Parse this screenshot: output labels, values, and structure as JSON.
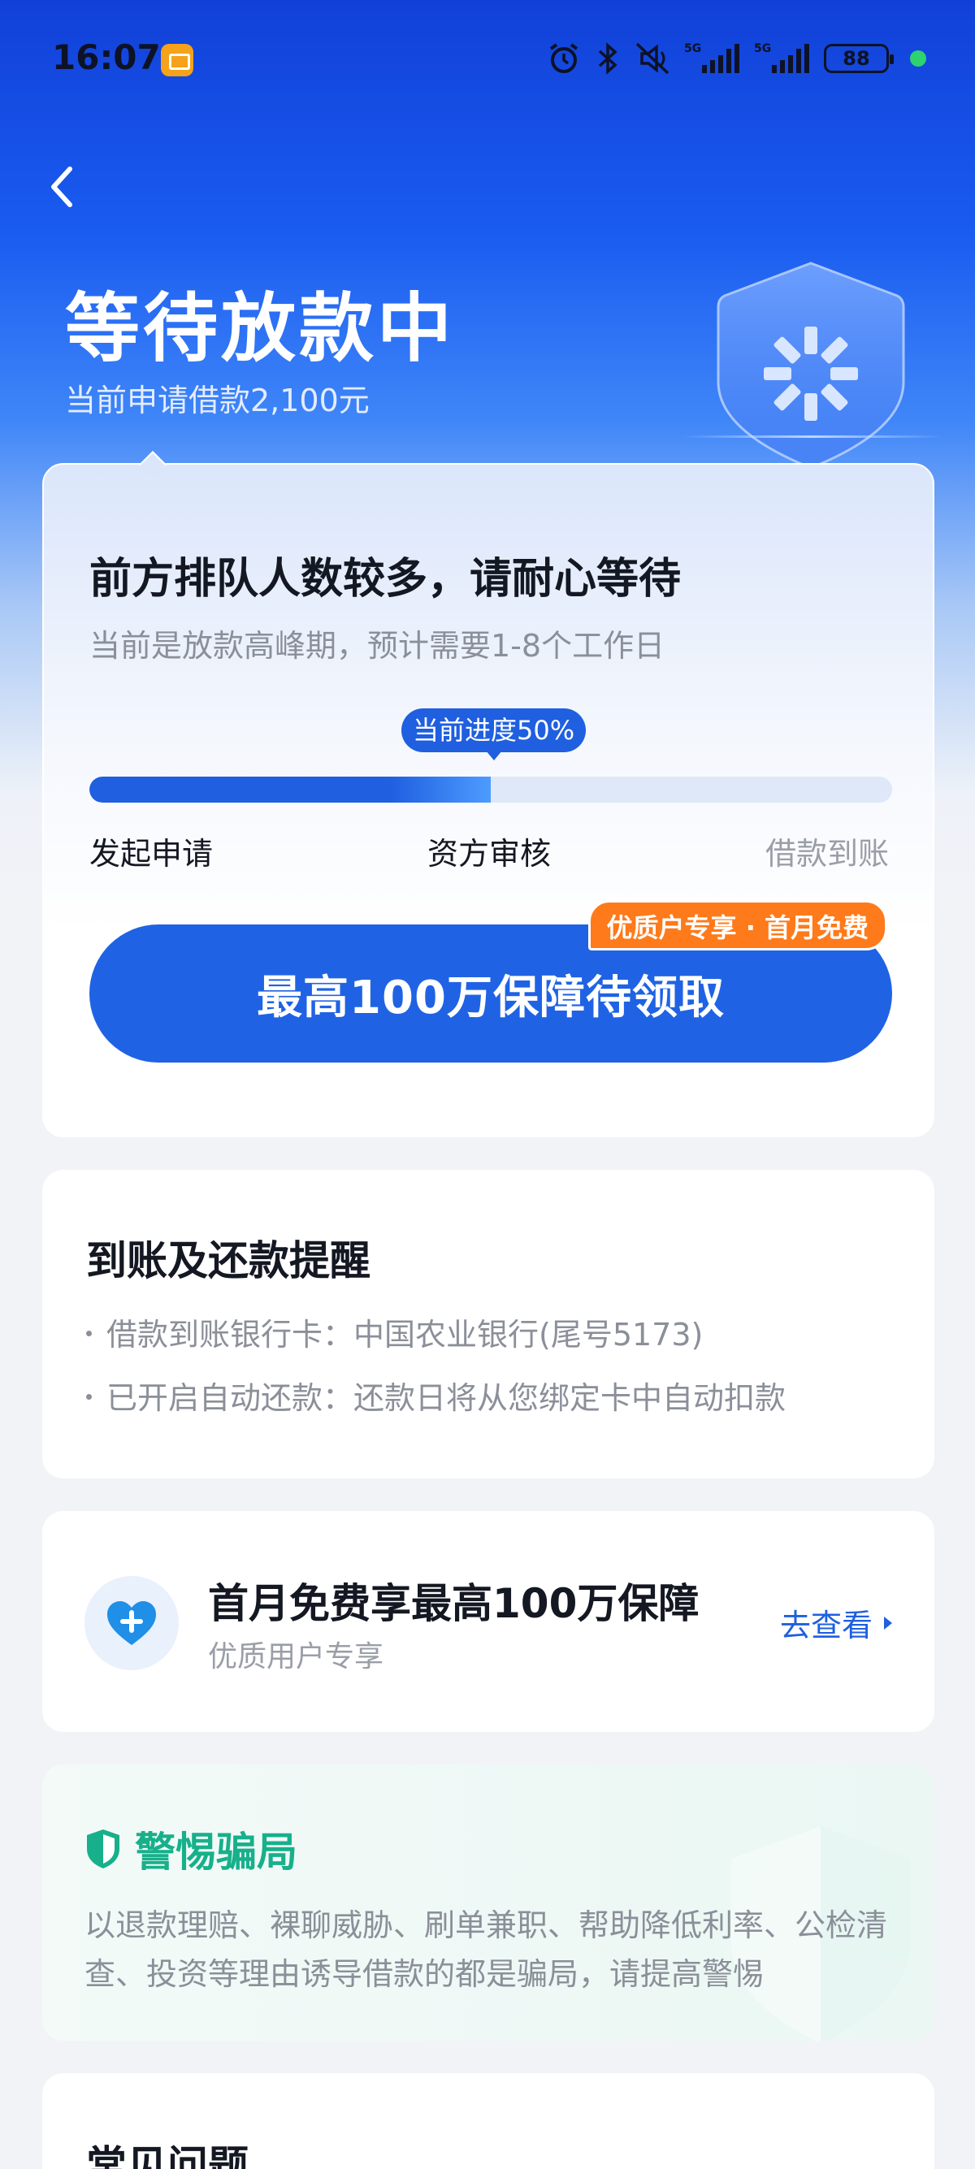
{
  "status_bar": {
    "time": "16:07",
    "battery": "88",
    "network_1": "5G",
    "network_2": "5G"
  },
  "header": {
    "title": "等待放款中",
    "subtitle": "当前申请借款2,100元"
  },
  "progress_card": {
    "heading": "前方排队人数较多，请耐心等待",
    "sub": "当前是放款高峰期，预计需要1-8个工作日",
    "progress_label": "当前进度50%",
    "progress_value": 0.5,
    "steps": [
      "发起申请",
      "资方审核",
      "借款到账"
    ],
    "cta_label": "最高100万保障待领取",
    "cta_badge": "优质户专享 · 首月免费"
  },
  "reminder_card": {
    "title": "到账及还款提醒",
    "items": [
      "借款到账银行卡：中国农业银行(尾号5173)",
      "已开启自动还款：还款日将从您绑定卡中自动扣款"
    ]
  },
  "promo_card": {
    "title": "首月免费享最高100万保障",
    "sub": "优质用户专享",
    "link": "去查看"
  },
  "fraud_card": {
    "title": "警惕骗局",
    "text": "以退款理赔、裸聊威胁、刷单兼职、帮助降低利率、公检清查、投资等理由诱导借款的都是骗局，请提高警惕"
  },
  "faq_card": {
    "title": "常见问题"
  },
  "colors": {
    "primary": "#1f5fe0",
    "accent_orange": "#ff7a1a",
    "fraud_green": "#17b08b"
  }
}
